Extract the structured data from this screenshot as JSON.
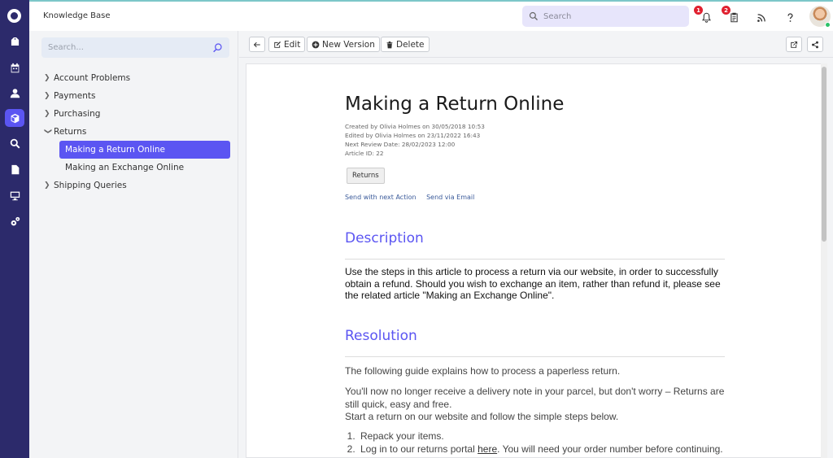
{
  "app": {
    "title": "Knowledge Base"
  },
  "topbar": {
    "search_placeholder": "Search",
    "notifications_count": "1",
    "tasks_count": "2"
  },
  "sidebar": {
    "search_placeholder": "Search...",
    "tree": [
      {
        "label": "Account Problems"
      },
      {
        "label": "Payments"
      },
      {
        "label": "Purchasing"
      },
      {
        "label": "Returns",
        "expanded": true,
        "children": [
          {
            "label": "Making a Return Online",
            "active": true
          },
          {
            "label": "Making an Exchange Online"
          }
        ]
      },
      {
        "label": "Shipping Queries"
      }
    ]
  },
  "toolbar": {
    "edit_label": "Edit",
    "new_version_label": "New Version",
    "delete_label": "Delete"
  },
  "article": {
    "title": "Making a Return Online",
    "created": "Created by Olivia Holmes on 30/05/2018 10:53",
    "edited": "Edited by Olivia Holmes on 23/11/2022 16:43",
    "next_review": "Next Review Date: 28/02/2023 12:00",
    "article_id": "Article ID: 22",
    "tag": "Returns",
    "send_next_action": "Send with next Action",
    "send_email": "Send via Email",
    "description_heading": "Description",
    "description_text": "Use the steps in this article to process a return via our website, in order to successfully obtain a refund. Should you wish to exchange an item, rather than refund it, please see the related article \"Making an Exchange Online\".",
    "resolution_heading": "Resolution",
    "resolution_p1": "The following guide explains how to process a paperless return.",
    "resolution_p2a": "You'll now no longer receive a delivery note in your parcel, but don't worry – Returns are still quick, easy and free.",
    "resolution_p2b": "Start a return on our website and follow the simple steps below.",
    "step1": "Repack your items.",
    "step2_pre": "Log in to our returns portal ",
    "step2_link": "here",
    "step2_post": ". You will need your order number before continuing."
  },
  "colors": {
    "rail": "#2c2a6b",
    "accent": "#5b55f2",
    "badge": "#e0202f"
  }
}
